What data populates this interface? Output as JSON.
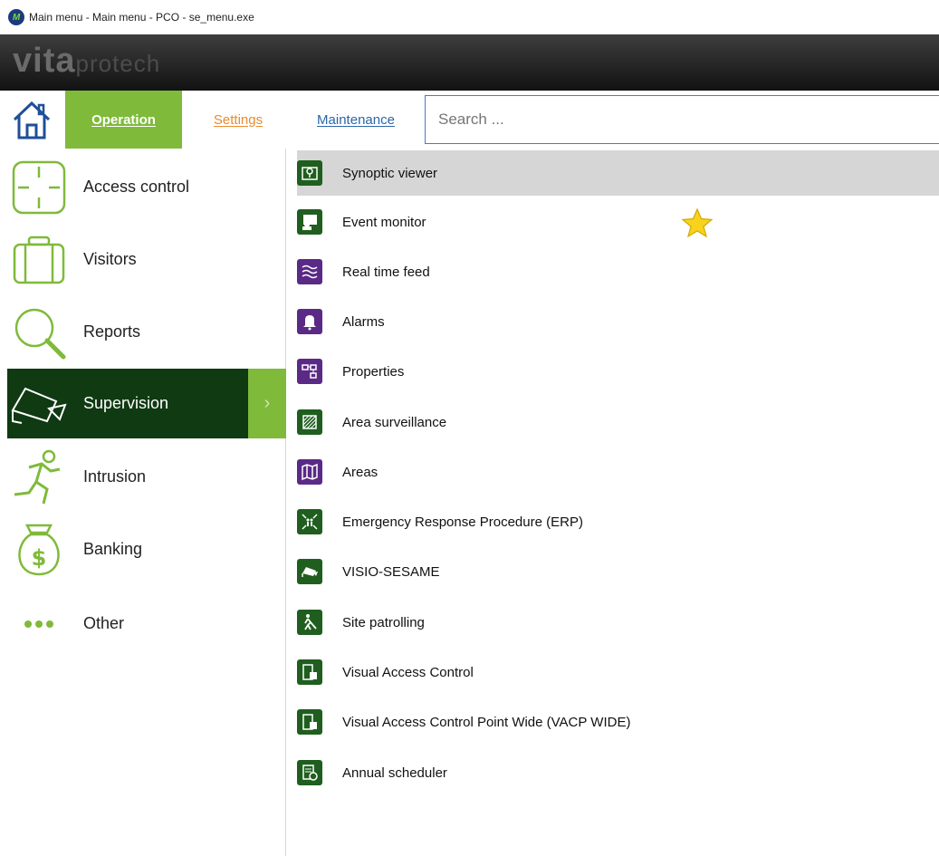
{
  "window": {
    "title": "Main menu - Main menu - PCO - se_menu.exe",
    "app_icon": "M"
  },
  "banner": {
    "logo_bold": "vita",
    "logo_light": "protech"
  },
  "toolbar": {
    "home_icon": "house-icon",
    "tabs": [
      {
        "label": "Operation",
        "accel": "O",
        "color": "#ffffff"
      },
      {
        "label": "Settings",
        "accel": "S",
        "color": "#e98a2b"
      },
      {
        "label": "Maintenance",
        "accel": "M",
        "color": "#2966a8"
      }
    ],
    "search_placeholder": "Search ..."
  },
  "sidebar": {
    "items": [
      {
        "label": "Access control",
        "icon": "access-control-icon"
      },
      {
        "label": "Visitors",
        "icon": "briefcase-icon"
      },
      {
        "label": "Reports",
        "icon": "magnifier-icon"
      },
      {
        "label": "Supervision",
        "icon": "camera-icon",
        "active": true
      },
      {
        "label": "Intrusion",
        "icon": "running-person-icon"
      },
      {
        "label": "Banking",
        "icon": "money-bag-icon"
      },
      {
        "label": "Other",
        "icon": "more-dots-icon"
      }
    ],
    "chevron": "›"
  },
  "menu": {
    "items": [
      {
        "label": "Synoptic viewer",
        "icon": "map-pin-icon",
        "color": "green",
        "selected": true
      },
      {
        "label": "Event monitor",
        "icon": "monitor-person-icon",
        "color": "green",
        "favorite": true
      },
      {
        "label": "Real time feed",
        "icon": "waves-icon",
        "color": "purple"
      },
      {
        "label": "Alarms",
        "icon": "bell-icon",
        "color": "purple"
      },
      {
        "label": "Properties",
        "icon": "hierarchy-icon",
        "color": "purple"
      },
      {
        "label": "Area surveillance",
        "icon": "hatched-area-icon",
        "color": "green"
      },
      {
        "label": "Areas",
        "icon": "map-icon",
        "color": "purple"
      },
      {
        "label": "Emergency Response Procedure (ERP)",
        "icon": "evacuation-icon",
        "color": "green"
      },
      {
        "label": "VISIO-SESAME",
        "icon": "cctv-camera-icon",
        "color": "green"
      },
      {
        "label": "Site patrolling",
        "icon": "patrol-walker-icon",
        "color": "green"
      },
      {
        "label": "Visual Access Control",
        "icon": "door-hand-icon",
        "color": "green"
      },
      {
        "label": "Visual Access Control Point Wide (VACP WIDE)",
        "icon": "door-hand-icon",
        "color": "green"
      },
      {
        "label": "Annual scheduler",
        "icon": "calendar-clock-icon",
        "color": "green"
      }
    ]
  },
  "colors": {
    "accent": "#7fba3a",
    "active_bg": "#0f3a12",
    "icon_green": "#1f5e1f",
    "icon_purple": "#5a2a86",
    "selected_row": "#d6d6d6"
  }
}
